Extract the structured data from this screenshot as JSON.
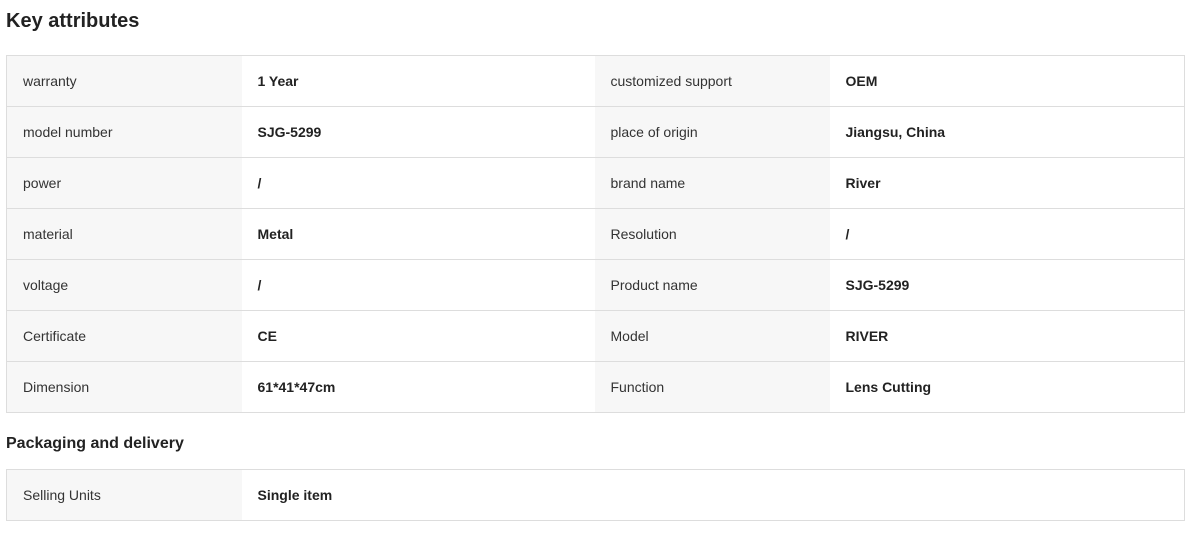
{
  "key_attributes": {
    "title": "Key attributes",
    "rows": [
      {
        "k1": "warranty",
        "v1": "1 Year",
        "k2": "customized support",
        "v2": "OEM"
      },
      {
        "k1": "model number",
        "v1": "SJG-5299",
        "k2": "place of origin",
        "v2": "Jiangsu, China"
      },
      {
        "k1": "power",
        "v1": "/",
        "k2": "brand name",
        "v2": "River"
      },
      {
        "k1": "material",
        "v1": "Metal",
        "k2": "Resolution",
        "v2": "/"
      },
      {
        "k1": "voltage",
        "v1": "/",
        "k2": "Product name",
        "v2": "SJG-5299"
      },
      {
        "k1": "Certificate",
        "v1": "CE",
        "k2": "Model",
        "v2": "RIVER"
      },
      {
        "k1": "Dimension",
        "v1": "61*41*47cm",
        "k2": "Function",
        "v2": "Lens Cutting"
      }
    ]
  },
  "packaging": {
    "title": "Packaging and delivery",
    "rows": [
      {
        "k1": "Selling Units",
        "v1": "Single item"
      }
    ]
  }
}
